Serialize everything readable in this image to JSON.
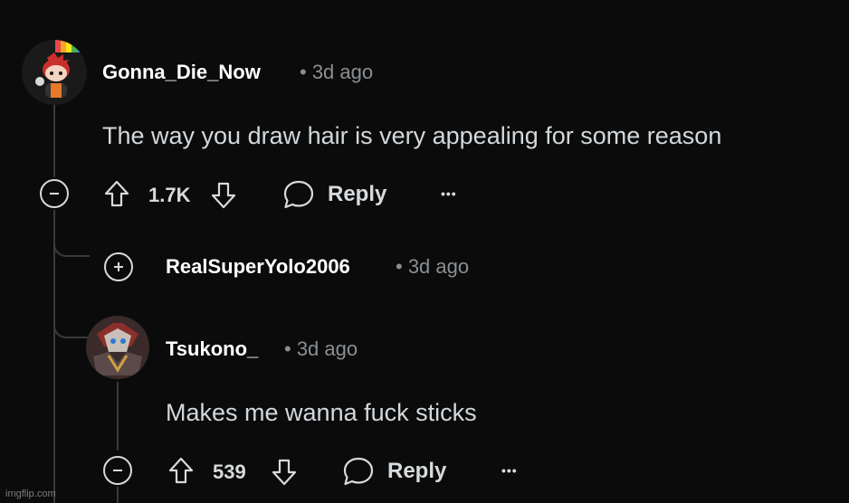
{
  "comments": [
    {
      "username": "Gonna_Die_Now",
      "time": "• 3d ago",
      "body": "The way you draw hair is very appealing for some reason",
      "votes": "1.7K",
      "reply_label": "Reply",
      "more_label": "•••"
    },
    {
      "username": "RealSuperYolo2006",
      "time": "• 3d ago"
    },
    {
      "username": "Tsukono_",
      "time": "• 3d ago",
      "body": "Makes me wanna fuck sticks",
      "votes": "539",
      "reply_label": "Reply",
      "more_label": "•••"
    }
  ],
  "watermark": "imgflip.com",
  "colors": {
    "background": "#0b0b0b",
    "text": "#d7dadc",
    "muted": "#8b8f93",
    "thread_line": "#3a3a3a"
  }
}
